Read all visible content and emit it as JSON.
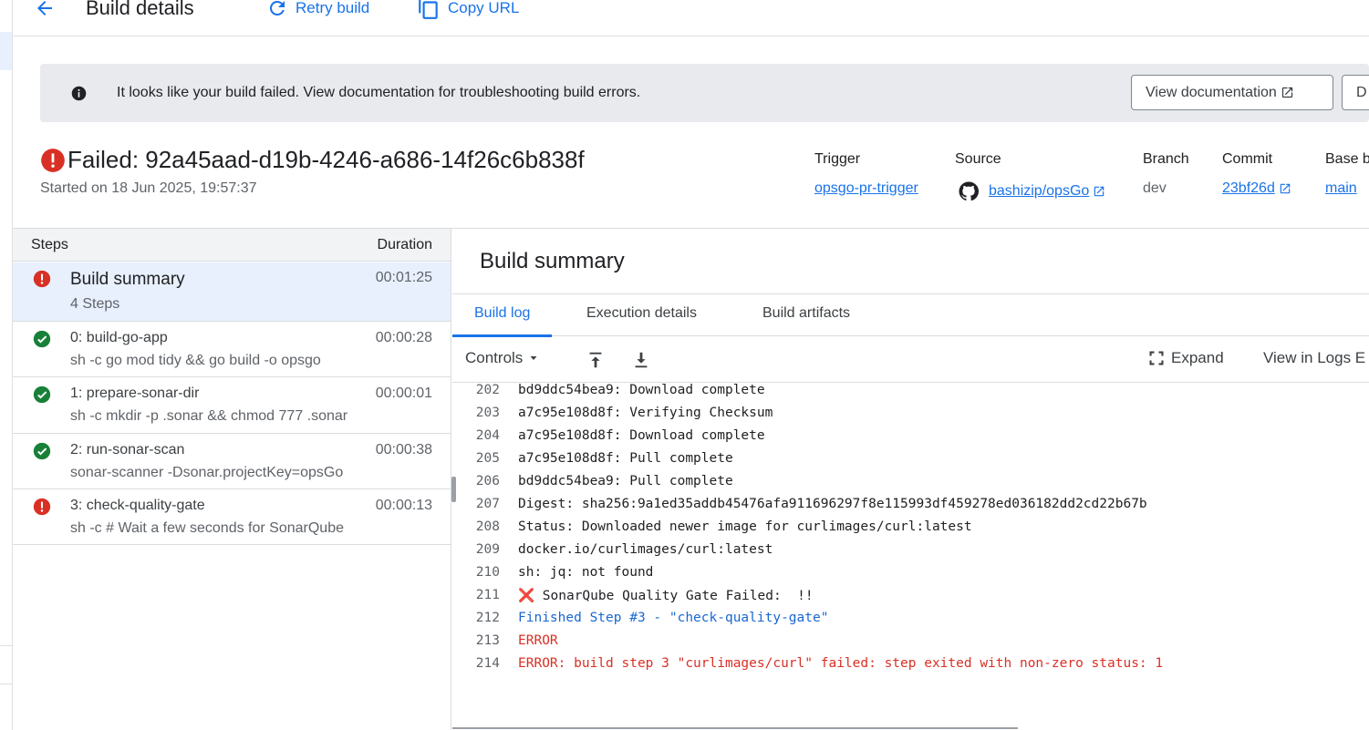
{
  "header": {
    "title": "Build details",
    "actions": [
      {
        "label": "Retry build",
        "icon": "refresh-icon"
      },
      {
        "label": "Copy URL",
        "icon": "copy-icon"
      }
    ]
  },
  "banner": {
    "message": "It looks like your build failed. View documentation for troubleshooting build errors.",
    "view_doc_label": "View documentation",
    "second_button_label": "D"
  },
  "build": {
    "status_title": "Failed: 92a45aad-d19b-4246-a686-14f26c6b838f",
    "started": "Started on 18 Jun 2025, 19:57:37"
  },
  "meta": {
    "trigger": {
      "label": "Trigger",
      "value": "opsgo-pr-trigger"
    },
    "source": {
      "label": "Source",
      "value": "bashizip/opsGo"
    },
    "branch": {
      "label": "Branch",
      "value": "dev"
    },
    "commit": {
      "label": "Commit",
      "value": "23bf26d"
    },
    "base": {
      "label": "Base b",
      "value": "main"
    }
  },
  "steps_panel": {
    "col_steps": "Steps",
    "col_duration": "Duration",
    "items": [
      {
        "name": "Build summary",
        "sub": "4 Steps",
        "duration": "00:01:25",
        "status": "error"
      },
      {
        "name": "0: build-go-app",
        "sub": "sh -c go mod tidy && go build -o opsgo",
        "duration": "00:00:28",
        "status": "success"
      },
      {
        "name": "1: prepare-sonar-dir",
        "sub": "sh -c mkdir -p .sonar && chmod 777 .sonar",
        "duration": "00:00:01",
        "status": "success"
      },
      {
        "name": "2: run-sonar-scan",
        "sub": "sonar-scanner -Dsonar.projectKey=opsGo",
        "duration": "00:00:38",
        "status": "success"
      },
      {
        "name": "3: check-quality-gate",
        "sub": "sh -c # Wait a few seconds for SonarQube",
        "duration": "00:00:13",
        "status": "error"
      }
    ]
  },
  "detail": {
    "title": "Build summary",
    "tabs": [
      "Build log",
      "Execution details",
      "Build artifacts"
    ],
    "controls": {
      "controls_label": "Controls",
      "expand_label": "Expand",
      "view_logs_label": "View in Logs E"
    }
  },
  "log": [
    {
      "n": "202",
      "text": "bd9ddc54bea9: Download complete",
      "style": "normal"
    },
    {
      "n": "203",
      "text": "a7c95e108d8f: Verifying Checksum",
      "style": "normal"
    },
    {
      "n": "204",
      "text": "a7c95e108d8f: Download complete",
      "style": "normal"
    },
    {
      "n": "205",
      "text": "a7c95e108d8f: Pull complete",
      "style": "normal"
    },
    {
      "n": "206",
      "text": "bd9ddc54bea9: Pull complete",
      "style": "normal"
    },
    {
      "n": "207",
      "text": "Digest: sha256:9a1ed35addb45476afa911696297f8e115993df459278ed036182dd2cd22b67b",
      "style": "normal"
    },
    {
      "n": "208",
      "text": "Status: Downloaded newer image for curlimages/curl:latest",
      "style": "normal"
    },
    {
      "n": "209",
      "text": "docker.io/curlimages/curl:latest",
      "style": "normal"
    },
    {
      "n": "210",
      "text": "sh: jq: not found",
      "style": "normal"
    },
    {
      "n": "211",
      "text": "❌ SonarQube Quality Gate Failed:  !!",
      "style": "normal"
    },
    {
      "n": "212",
      "text": "Finished Step #3 - \"check-quality-gate\"",
      "style": "blue"
    },
    {
      "n": "213",
      "text": "ERROR",
      "style": "red"
    },
    {
      "n": "214",
      "text": "ERROR: build step 3 \"curlimages/curl\" failed: step exited with non-zero status: 1",
      "style": "red"
    }
  ],
  "colors": {
    "accent": "#1a73e8",
    "error": "#d93025",
    "success": "#188038"
  }
}
